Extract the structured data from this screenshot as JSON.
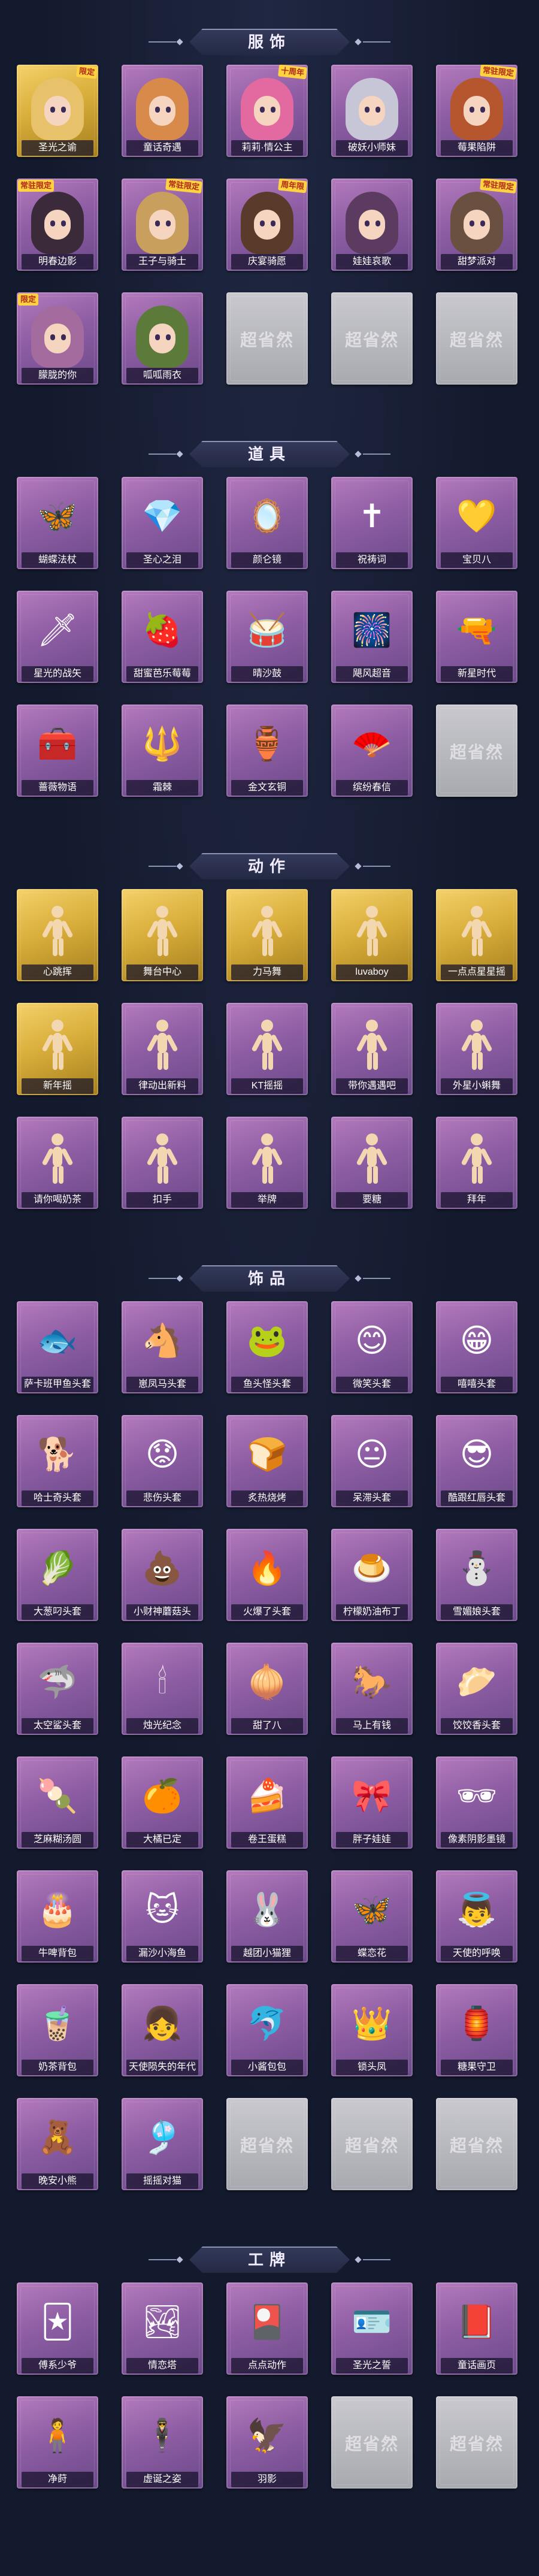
{
  "sections": [
    {
      "title": "服饰",
      "kind": "avatar",
      "items": [
        {
          "name": "圣光之谕",
          "tag": "限定",
          "tag_side": "right",
          "rarity": "gold",
          "hair": "#e8c26a"
        },
        {
          "name": "童话奇遇",
          "rarity": "purple",
          "hair": "#d88a4a"
        },
        {
          "name": "莉莉·情公主",
          "tag": "十周年",
          "tag_side": "right",
          "rarity": "purple",
          "hair": "#e36aa0"
        },
        {
          "name": "破妖小师妹",
          "rarity": "purple",
          "hair": "#c6c6d6"
        },
        {
          "name": "莓果陷阱",
          "tag": "常驻限定",
          "tag_side": "right",
          "rarity": "purple",
          "hair": "#b5562e"
        },
        {
          "name": "明春边影",
          "tag": "常驻限定",
          "tag_side": "left",
          "rarity": "purple",
          "hair": "#3a2a3a"
        },
        {
          "name": "王子与骑士",
          "tag": "常驻限定",
          "tag_side": "right",
          "rarity": "purple",
          "hair": "#c89f5c"
        },
        {
          "name": "庆宴骑愿",
          "tag": "周年限",
          "tag_side": "right",
          "rarity": "purple",
          "hair": "#5a3a2a"
        },
        {
          "name": "娃娃哀歌",
          "rarity": "purple",
          "hair": "#5b3b5f"
        },
        {
          "name": "甜梦派对",
          "tag": "常驻限定",
          "tag_side": "right",
          "rarity": "purple",
          "hair": "#6a5040"
        },
        {
          "name": "朦胧的你",
          "tag": "限定",
          "tag_side": "left",
          "rarity": "purple",
          "hair": "#a36b9e"
        },
        {
          "name": "呱呱雨衣",
          "rarity": "purple",
          "hair": "#5c7a3a"
        },
        {
          "name": "",
          "rarity": "empty"
        },
        {
          "name": "",
          "rarity": "empty"
        },
        {
          "name": "",
          "rarity": "empty"
        }
      ]
    },
    {
      "title": "道具",
      "kind": "icon",
      "items": [
        {
          "name": "蝴蝶法杖",
          "icon": "🦋",
          "rarity": "purple"
        },
        {
          "name": "圣心之泪",
          "icon": "💎",
          "rarity": "purple"
        },
        {
          "name": "颜仑镜",
          "icon": "🪞",
          "rarity": "purple"
        },
        {
          "name": "祝祷词",
          "icon": "✝",
          "rarity": "purple"
        },
        {
          "name": "宝贝八",
          "icon": "💛",
          "rarity": "purple"
        },
        {
          "name": "星光的战矢",
          "icon": "🗡",
          "rarity": "purple"
        },
        {
          "name": "甜蜜芭乐莓莓",
          "icon": "🍓",
          "rarity": "purple"
        },
        {
          "name": "晴沙鼓",
          "icon": "🥁",
          "rarity": "purple"
        },
        {
          "name": "飓风超音",
          "icon": "🎆",
          "rarity": "purple"
        },
        {
          "name": "新星时代",
          "icon": "🔫",
          "rarity": "purple"
        },
        {
          "name": "蔷薇物语",
          "icon": "🧰",
          "rarity": "purple"
        },
        {
          "name": "霜棘",
          "icon": "🔱",
          "rarity": "purple"
        },
        {
          "name": "金文玄铜",
          "icon": "🏺",
          "rarity": "purple"
        },
        {
          "name": "缤纷春信",
          "icon": "🪭",
          "rarity": "purple"
        },
        {
          "name": "",
          "rarity": "empty"
        }
      ]
    },
    {
      "title": "动作",
      "kind": "pose",
      "items": [
        {
          "name": "心跳挥",
          "rarity": "gold"
        },
        {
          "name": "舞台中心",
          "rarity": "gold"
        },
        {
          "name": "力马舞",
          "rarity": "gold"
        },
        {
          "name": "luvaboy",
          "rarity": "gold"
        },
        {
          "name": "一点点星星摇",
          "rarity": "gold"
        },
        {
          "name": "新年摇",
          "rarity": "gold"
        },
        {
          "name": "律动出新料",
          "rarity": "purple"
        },
        {
          "name": "KT摇摇",
          "rarity": "purple"
        },
        {
          "name": "带你遇遇吧",
          "rarity": "purple"
        },
        {
          "name": "外星小蝌舞",
          "rarity": "purple"
        },
        {
          "name": "请你喝奶茶",
          "rarity": "purple"
        },
        {
          "name": "扣手",
          "rarity": "purple"
        },
        {
          "name": "举牌",
          "rarity": "purple"
        },
        {
          "name": "要糖",
          "rarity": "purple"
        },
        {
          "name": "拜年",
          "rarity": "purple"
        }
      ]
    },
    {
      "title": "饰品",
      "kind": "icon",
      "items": [
        {
          "name": "萨卡班甲鱼头套",
          "icon": "🐟",
          "rarity": "purple"
        },
        {
          "name": "崽凤马头套",
          "icon": "🐴",
          "rarity": "purple"
        },
        {
          "name": "鱼头怪头套",
          "icon": "🐸",
          "rarity": "purple"
        },
        {
          "name": "微笑头套",
          "icon": "😊",
          "rarity": "purple"
        },
        {
          "name": "嘻嘻头套",
          "icon": "😁",
          "rarity": "purple"
        },
        {
          "name": "哈士奇头套",
          "icon": "🐕",
          "rarity": "purple"
        },
        {
          "name": "悲伤头套",
          "icon": "😟",
          "rarity": "purple"
        },
        {
          "name": "炙热烧烤",
          "icon": "🍞",
          "rarity": "purple"
        },
        {
          "name": "呆滞头套",
          "icon": "😐",
          "rarity": "purple"
        },
        {
          "name": "酷跟红唇头套",
          "icon": "😎",
          "rarity": "purple"
        },
        {
          "name": "大葱叼头套",
          "icon": "🥬",
          "rarity": "purple"
        },
        {
          "name": "小财神蘑菇头",
          "icon": "💩",
          "rarity": "purple"
        },
        {
          "name": "火爆了头套",
          "icon": "🔥",
          "rarity": "purple"
        },
        {
          "name": "柠檬奶油布丁",
          "icon": "🍮",
          "rarity": "purple"
        },
        {
          "name": "雪媚娘头套",
          "icon": "⛄",
          "rarity": "purple"
        },
        {
          "name": "太空鲨头套",
          "icon": "🦈",
          "rarity": "purple"
        },
        {
          "name": "烛光纪念",
          "icon": "🕯",
          "rarity": "purple"
        },
        {
          "name": "甜了八",
          "icon": "🧅",
          "rarity": "purple"
        },
        {
          "name": "马上有钱",
          "icon": "🐎",
          "rarity": "purple"
        },
        {
          "name": "饺饺香头套",
          "icon": "🥟",
          "rarity": "purple"
        },
        {
          "name": "芝麻糊汤圆",
          "icon": "🍡",
          "rarity": "purple"
        },
        {
          "name": "大橘已定",
          "icon": "🍊",
          "rarity": "purple"
        },
        {
          "name": "卷王蛋糕",
          "icon": "🍰",
          "rarity": "purple"
        },
        {
          "name": "胖子娃娃",
          "icon": "🎀",
          "rarity": "purple"
        },
        {
          "name": "像素阴影墨镜",
          "icon": "🕶",
          "rarity": "purple"
        },
        {
          "name": "牛啤背包",
          "icon": "🎂",
          "rarity": "purple"
        },
        {
          "name": "漏沙小海鱼",
          "icon": "🐱",
          "rarity": "purple"
        },
        {
          "name": "越团小猫狸",
          "icon": "🐰",
          "rarity": "purple"
        },
        {
          "name": "蝶恋花",
          "icon": "🦋",
          "rarity": "purple"
        },
        {
          "name": "天使的呼唤",
          "icon": "👼",
          "rarity": "purple"
        },
        {
          "name": "奶茶背包",
          "icon": "🧋",
          "rarity": "purple"
        },
        {
          "name": "天使陨失的年代",
          "icon": "👧",
          "rarity": "purple"
        },
        {
          "name": "小酱包包",
          "icon": "🐬",
          "rarity": "purple"
        },
        {
          "name": "锁头凤",
          "icon": "👑",
          "rarity": "purple"
        },
        {
          "name": "糖果守卫",
          "icon": "🏮",
          "rarity": "purple"
        },
        {
          "name": "晚安小熊",
          "icon": "🧸",
          "rarity": "purple"
        },
        {
          "name": "摇摇对猫",
          "icon": "🎐",
          "rarity": "purple"
        },
        {
          "name": "",
          "rarity": "empty"
        },
        {
          "name": "",
          "rarity": "empty"
        },
        {
          "name": "",
          "rarity": "empty"
        }
      ]
    },
    {
      "title": "工牌",
      "kind": "icon",
      "items": [
        {
          "name": "傅系少爷",
          "icon": "🃏",
          "rarity": "purple"
        },
        {
          "name": "情恋塔",
          "icon": "🏞",
          "rarity": "purple"
        },
        {
          "name": "点点动作",
          "icon": "🎴",
          "rarity": "purple"
        },
        {
          "name": "圣光之誓",
          "icon": "🪪",
          "rarity": "purple"
        },
        {
          "name": "童话画页",
          "icon": "📕",
          "rarity": "purple"
        },
        {
          "name": "净莳",
          "icon": "🧍",
          "rarity": "purple"
        },
        {
          "name": "虚诞之姿",
          "icon": "🕴",
          "rarity": "purple"
        },
        {
          "name": "羽影",
          "icon": "🦅",
          "rarity": "purple"
        },
        {
          "name": "",
          "rarity": "empty"
        },
        {
          "name": "",
          "rarity": "empty"
        }
      ]
    }
  ]
}
